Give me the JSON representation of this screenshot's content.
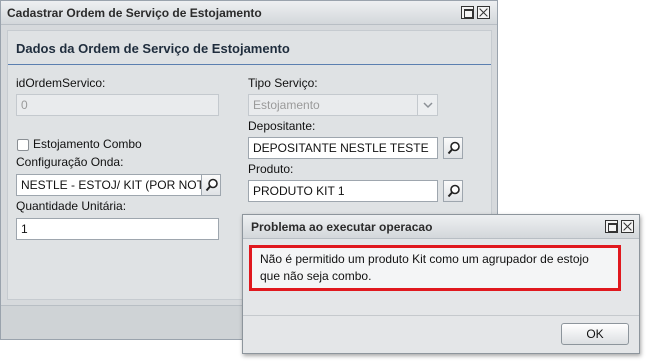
{
  "window": {
    "title": "Cadastrar Ordem de Serviço de Estojamento"
  },
  "section": {
    "title": "Dados da Ordem de Serviço de Estojamento"
  },
  "form": {
    "id_label": "idOrdemServico:",
    "id_value": "0",
    "tipo_label": "Tipo Serviço:",
    "tipo_value": "Estojamento",
    "depositante_label": "Depositante:",
    "depositante_value": "DEPOSITANTE NESTLE TESTE",
    "combo_label": "Estojamento Combo",
    "combo_checked": false,
    "config_label": "Configuração Onda:",
    "config_value": "NESTLE - ESTOJ/ KIT (POR NOTA",
    "produto_label": "Produto:",
    "produto_value": "PRODUTO KIT 1",
    "quantidade_label": "Quantidade Unitária:",
    "quantidade_value": "1"
  },
  "dialog": {
    "title": "Problema ao executar operacao",
    "message": "Não é permitido um produto Kit como um agrupador de estojo que não seja combo.",
    "ok_label": "OK",
    "highlight_color": "#e0181e"
  },
  "icons": {
    "lookup": "magnifier-icon",
    "dropdown": "chevron-down-icon",
    "maximize": "maximize-icon",
    "close": "close-icon"
  }
}
